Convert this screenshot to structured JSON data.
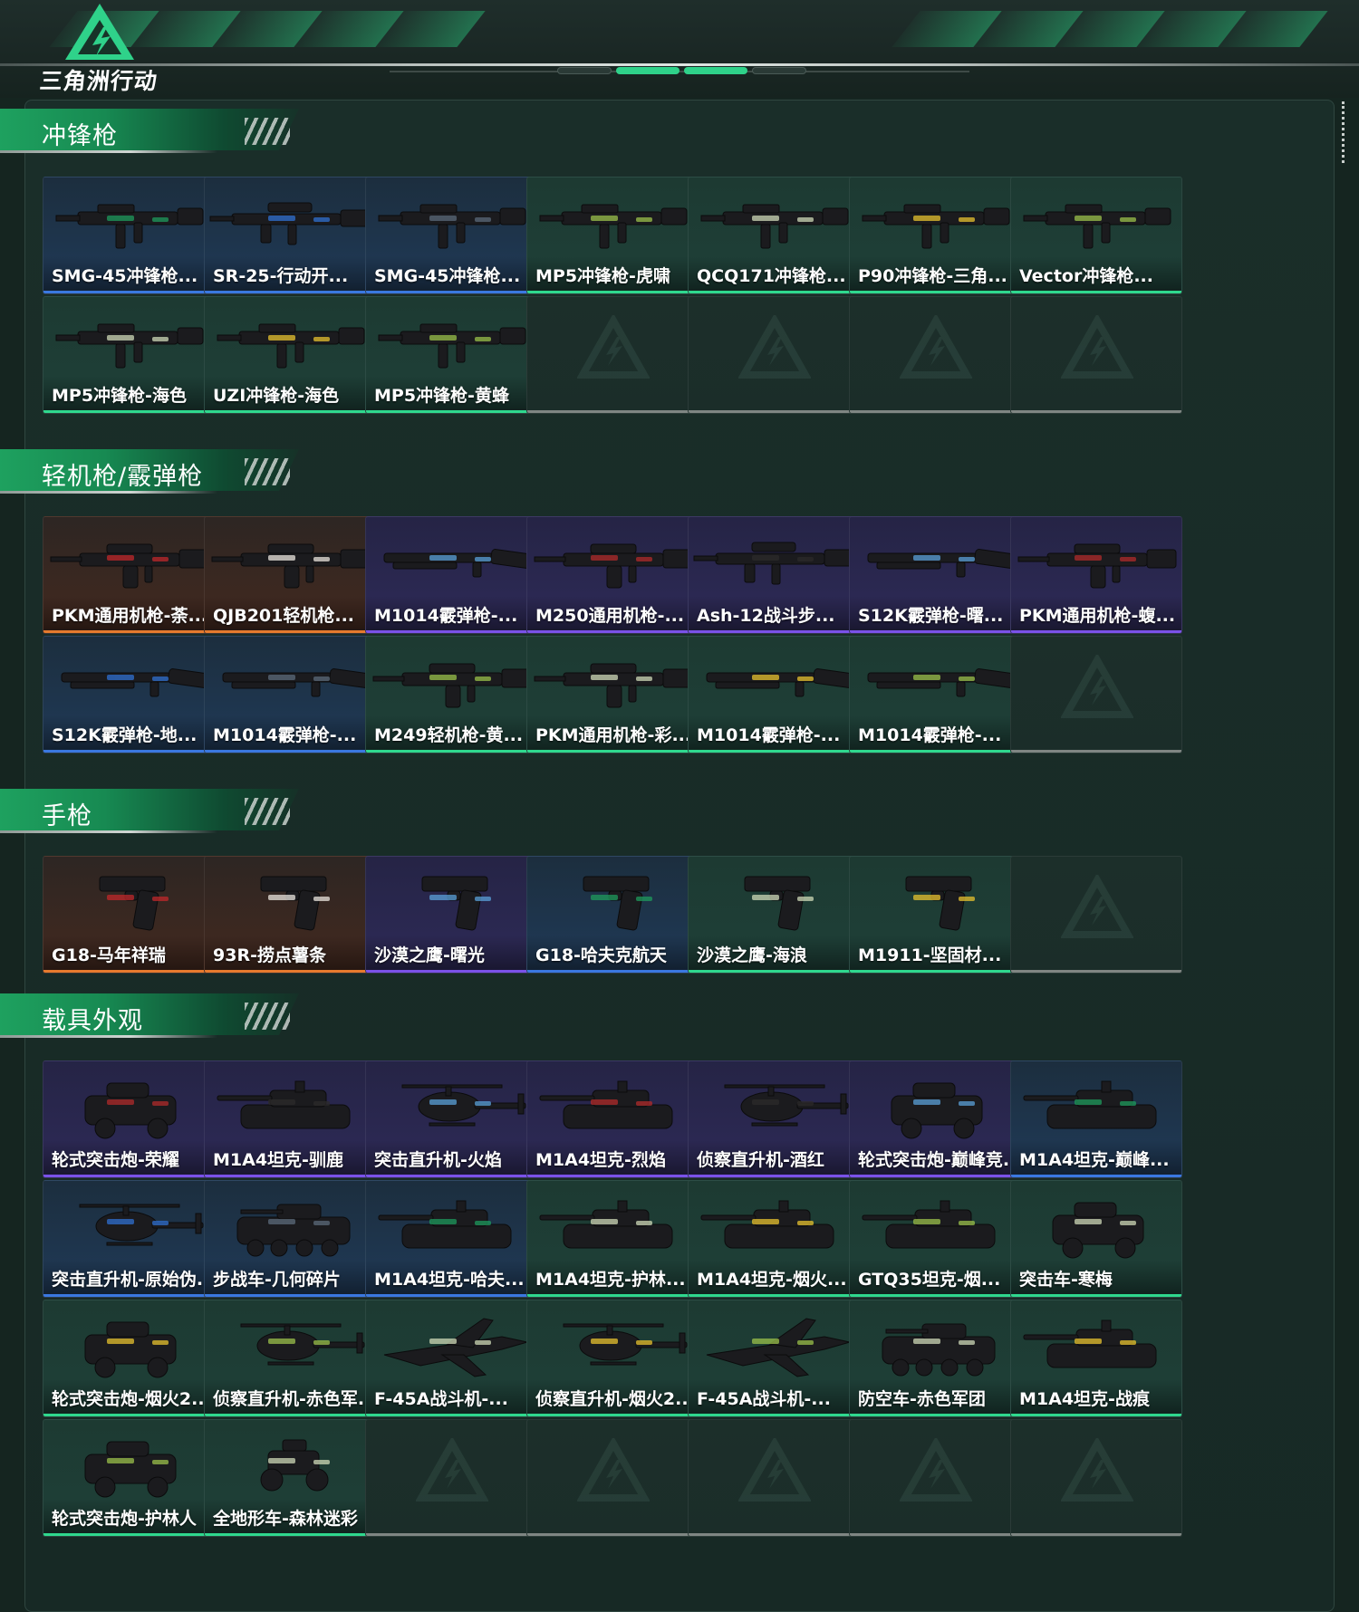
{
  "header": {
    "logo_title": "三角洲行动",
    "accent_color": "#2fd28a"
  },
  "sections": [
    {
      "title": "冲锋枪",
      "cards": [
        {
          "label": "SMG-45冲锋枪...",
          "rarity": "blue",
          "icon": "smg-icon"
        },
        {
          "label": "SR-25-行动开...",
          "rarity": "blue",
          "icon": "rifle-icon"
        },
        {
          "label": "SMG-45冲锋枪...",
          "rarity": "blue",
          "icon": "smg-icon"
        },
        {
          "label": "MP5冲锋枪-虎啸",
          "rarity": "green",
          "icon": "smg-icon"
        },
        {
          "label": "QCQ171冲锋枪...",
          "rarity": "green",
          "icon": "smg-icon"
        },
        {
          "label": "P90冲锋枪-三角...",
          "rarity": "green",
          "icon": "smg-icon"
        },
        {
          "label": "Vector冲锋枪...",
          "rarity": "green",
          "icon": "smg-icon"
        },
        {
          "label": "MP5冲锋枪-海色",
          "rarity": "green",
          "icon": "smg-icon"
        },
        {
          "label": "UZI冲锋枪-海色",
          "rarity": "green",
          "icon": "smg-icon"
        },
        {
          "label": "MP5冲锋枪-黄蜂",
          "rarity": "green",
          "icon": "smg-icon"
        },
        {
          "label": "",
          "rarity": "empty",
          "icon": "empty-slot-icon"
        },
        {
          "label": "",
          "rarity": "empty",
          "icon": "empty-slot-icon"
        },
        {
          "label": "",
          "rarity": "empty",
          "icon": "empty-slot-icon"
        },
        {
          "label": "",
          "rarity": "empty",
          "icon": "empty-slot-icon"
        }
      ]
    },
    {
      "title": "轻机枪/霰弹枪",
      "cards": [
        {
          "label": "PKM通用机枪-荼...",
          "rarity": "orange",
          "icon": "lmg-icon"
        },
        {
          "label": "QJB201轻机枪...",
          "rarity": "orange",
          "icon": "lmg-icon"
        },
        {
          "label": "M1014霰弹枪-...",
          "rarity": "purple",
          "icon": "shotgun-icon"
        },
        {
          "label": "M250通用机枪-...",
          "rarity": "purple",
          "icon": "lmg-icon"
        },
        {
          "label": "Ash-12战斗步...",
          "rarity": "purple",
          "icon": "rifle-icon"
        },
        {
          "label": "S12K霰弹枪-曙...",
          "rarity": "purple",
          "icon": "shotgun-icon"
        },
        {
          "label": "PKM通用机枪-蝮...",
          "rarity": "purple",
          "icon": "lmg-icon"
        },
        {
          "label": "S12K霰弹枪-地...",
          "rarity": "blue",
          "icon": "shotgun-icon"
        },
        {
          "label": "M1014霰弹枪-...",
          "rarity": "blue",
          "icon": "shotgun-icon"
        },
        {
          "label": "M249轻机枪-黄...",
          "rarity": "green",
          "icon": "lmg-icon"
        },
        {
          "label": "PKM通用机枪-彩...",
          "rarity": "green",
          "icon": "lmg-icon"
        },
        {
          "label": "M1014霰弹枪-...",
          "rarity": "green",
          "icon": "shotgun-icon"
        },
        {
          "label": "M1014霰弹枪-...",
          "rarity": "green",
          "icon": "shotgun-icon"
        },
        {
          "label": "",
          "rarity": "empty",
          "icon": "empty-slot-icon"
        }
      ]
    },
    {
      "title": "手枪",
      "cards": [
        {
          "label": "G18-马年祥瑞",
          "rarity": "orange",
          "icon": "pistol-icon"
        },
        {
          "label": "93R-捞点薯条",
          "rarity": "orange",
          "icon": "pistol-icon"
        },
        {
          "label": "沙漠之鹰-曙光",
          "rarity": "purple",
          "icon": "pistol-icon"
        },
        {
          "label": "G18-哈夫克航天",
          "rarity": "blue",
          "icon": "pistol-icon"
        },
        {
          "label": "沙漠之鹰-海浪",
          "rarity": "green",
          "icon": "pistol-icon"
        },
        {
          "label": "M1911-坚固材...",
          "rarity": "green",
          "icon": "pistol-icon"
        },
        {
          "label": "",
          "rarity": "empty",
          "icon": "empty-slot-icon"
        }
      ]
    },
    {
      "title": "载具外观",
      "cards": [
        {
          "label": "轮式突击炮-荣耀",
          "rarity": "purple",
          "icon": "armored-car-icon"
        },
        {
          "label": "M1A4坦克-驯鹿",
          "rarity": "purple",
          "icon": "tank-icon"
        },
        {
          "label": "突击直升机-火焰",
          "rarity": "purple",
          "icon": "helicopter-icon"
        },
        {
          "label": "M1A4坦克-烈焰",
          "rarity": "purple",
          "icon": "tank-icon"
        },
        {
          "label": "侦察直升机-酒红",
          "rarity": "purple",
          "icon": "helicopter-icon"
        },
        {
          "label": "轮式突击炮-巅峰竞...",
          "rarity": "purple",
          "icon": "armored-car-icon"
        },
        {
          "label": "M1A4坦克-巅峰...",
          "rarity": "blue",
          "icon": "tank-icon"
        },
        {
          "label": "突击直升机-原始伪...",
          "rarity": "blue",
          "icon": "helicopter-icon"
        },
        {
          "label": "步战车-几何碎片",
          "rarity": "blue",
          "icon": "ifv-icon"
        },
        {
          "label": "M1A4坦克-哈夫...",
          "rarity": "blue",
          "icon": "tank-icon"
        },
        {
          "label": "M1A4坦克-护林...",
          "rarity": "green",
          "icon": "tank-icon"
        },
        {
          "label": "M1A4坦克-烟火...",
          "rarity": "green",
          "icon": "tank-icon"
        },
        {
          "label": "GTQ35坦克-烟...",
          "rarity": "green",
          "icon": "tank-icon"
        },
        {
          "label": "突击车-寒梅",
          "rarity": "green",
          "icon": "armored-car-icon"
        },
        {
          "label": "轮式突击炮-烟火2...",
          "rarity": "green",
          "icon": "armored-car-icon"
        },
        {
          "label": "侦察直升机-赤色军...",
          "rarity": "green",
          "icon": "helicopter-icon"
        },
        {
          "label": "F-45A战斗机-...",
          "rarity": "green",
          "icon": "jet-icon"
        },
        {
          "label": "侦察直升机-烟火2...",
          "rarity": "green",
          "icon": "helicopter-icon"
        },
        {
          "label": "F-45A战斗机-...",
          "rarity": "green",
          "icon": "jet-icon"
        },
        {
          "label": "防空车-赤色军团",
          "rarity": "green",
          "icon": "ifv-icon"
        },
        {
          "label": "M1A4坦克-战痕",
          "rarity": "green",
          "icon": "tank-icon"
        },
        {
          "label": "轮式突击炮-护林人",
          "rarity": "green",
          "icon": "armored-car-icon"
        },
        {
          "label": "全地形车-森林迷彩",
          "rarity": "green",
          "icon": "atv-icon"
        },
        {
          "label": "",
          "rarity": "empty",
          "icon": "empty-slot-icon"
        },
        {
          "label": "",
          "rarity": "empty",
          "icon": "empty-slot-icon"
        },
        {
          "label": "",
          "rarity": "empty",
          "icon": "empty-slot-icon"
        },
        {
          "label": "",
          "rarity": "empty",
          "icon": "empty-slot-icon"
        },
        {
          "label": "",
          "rarity": "empty",
          "icon": "empty-slot-icon"
        }
      ]
    }
  ],
  "rarity_colors": {
    "green": "#2fd88e",
    "blue": "#3a78e0",
    "purple": "#7a52e8",
    "orange": "#e67a2e",
    "empty": "#7f8683"
  }
}
